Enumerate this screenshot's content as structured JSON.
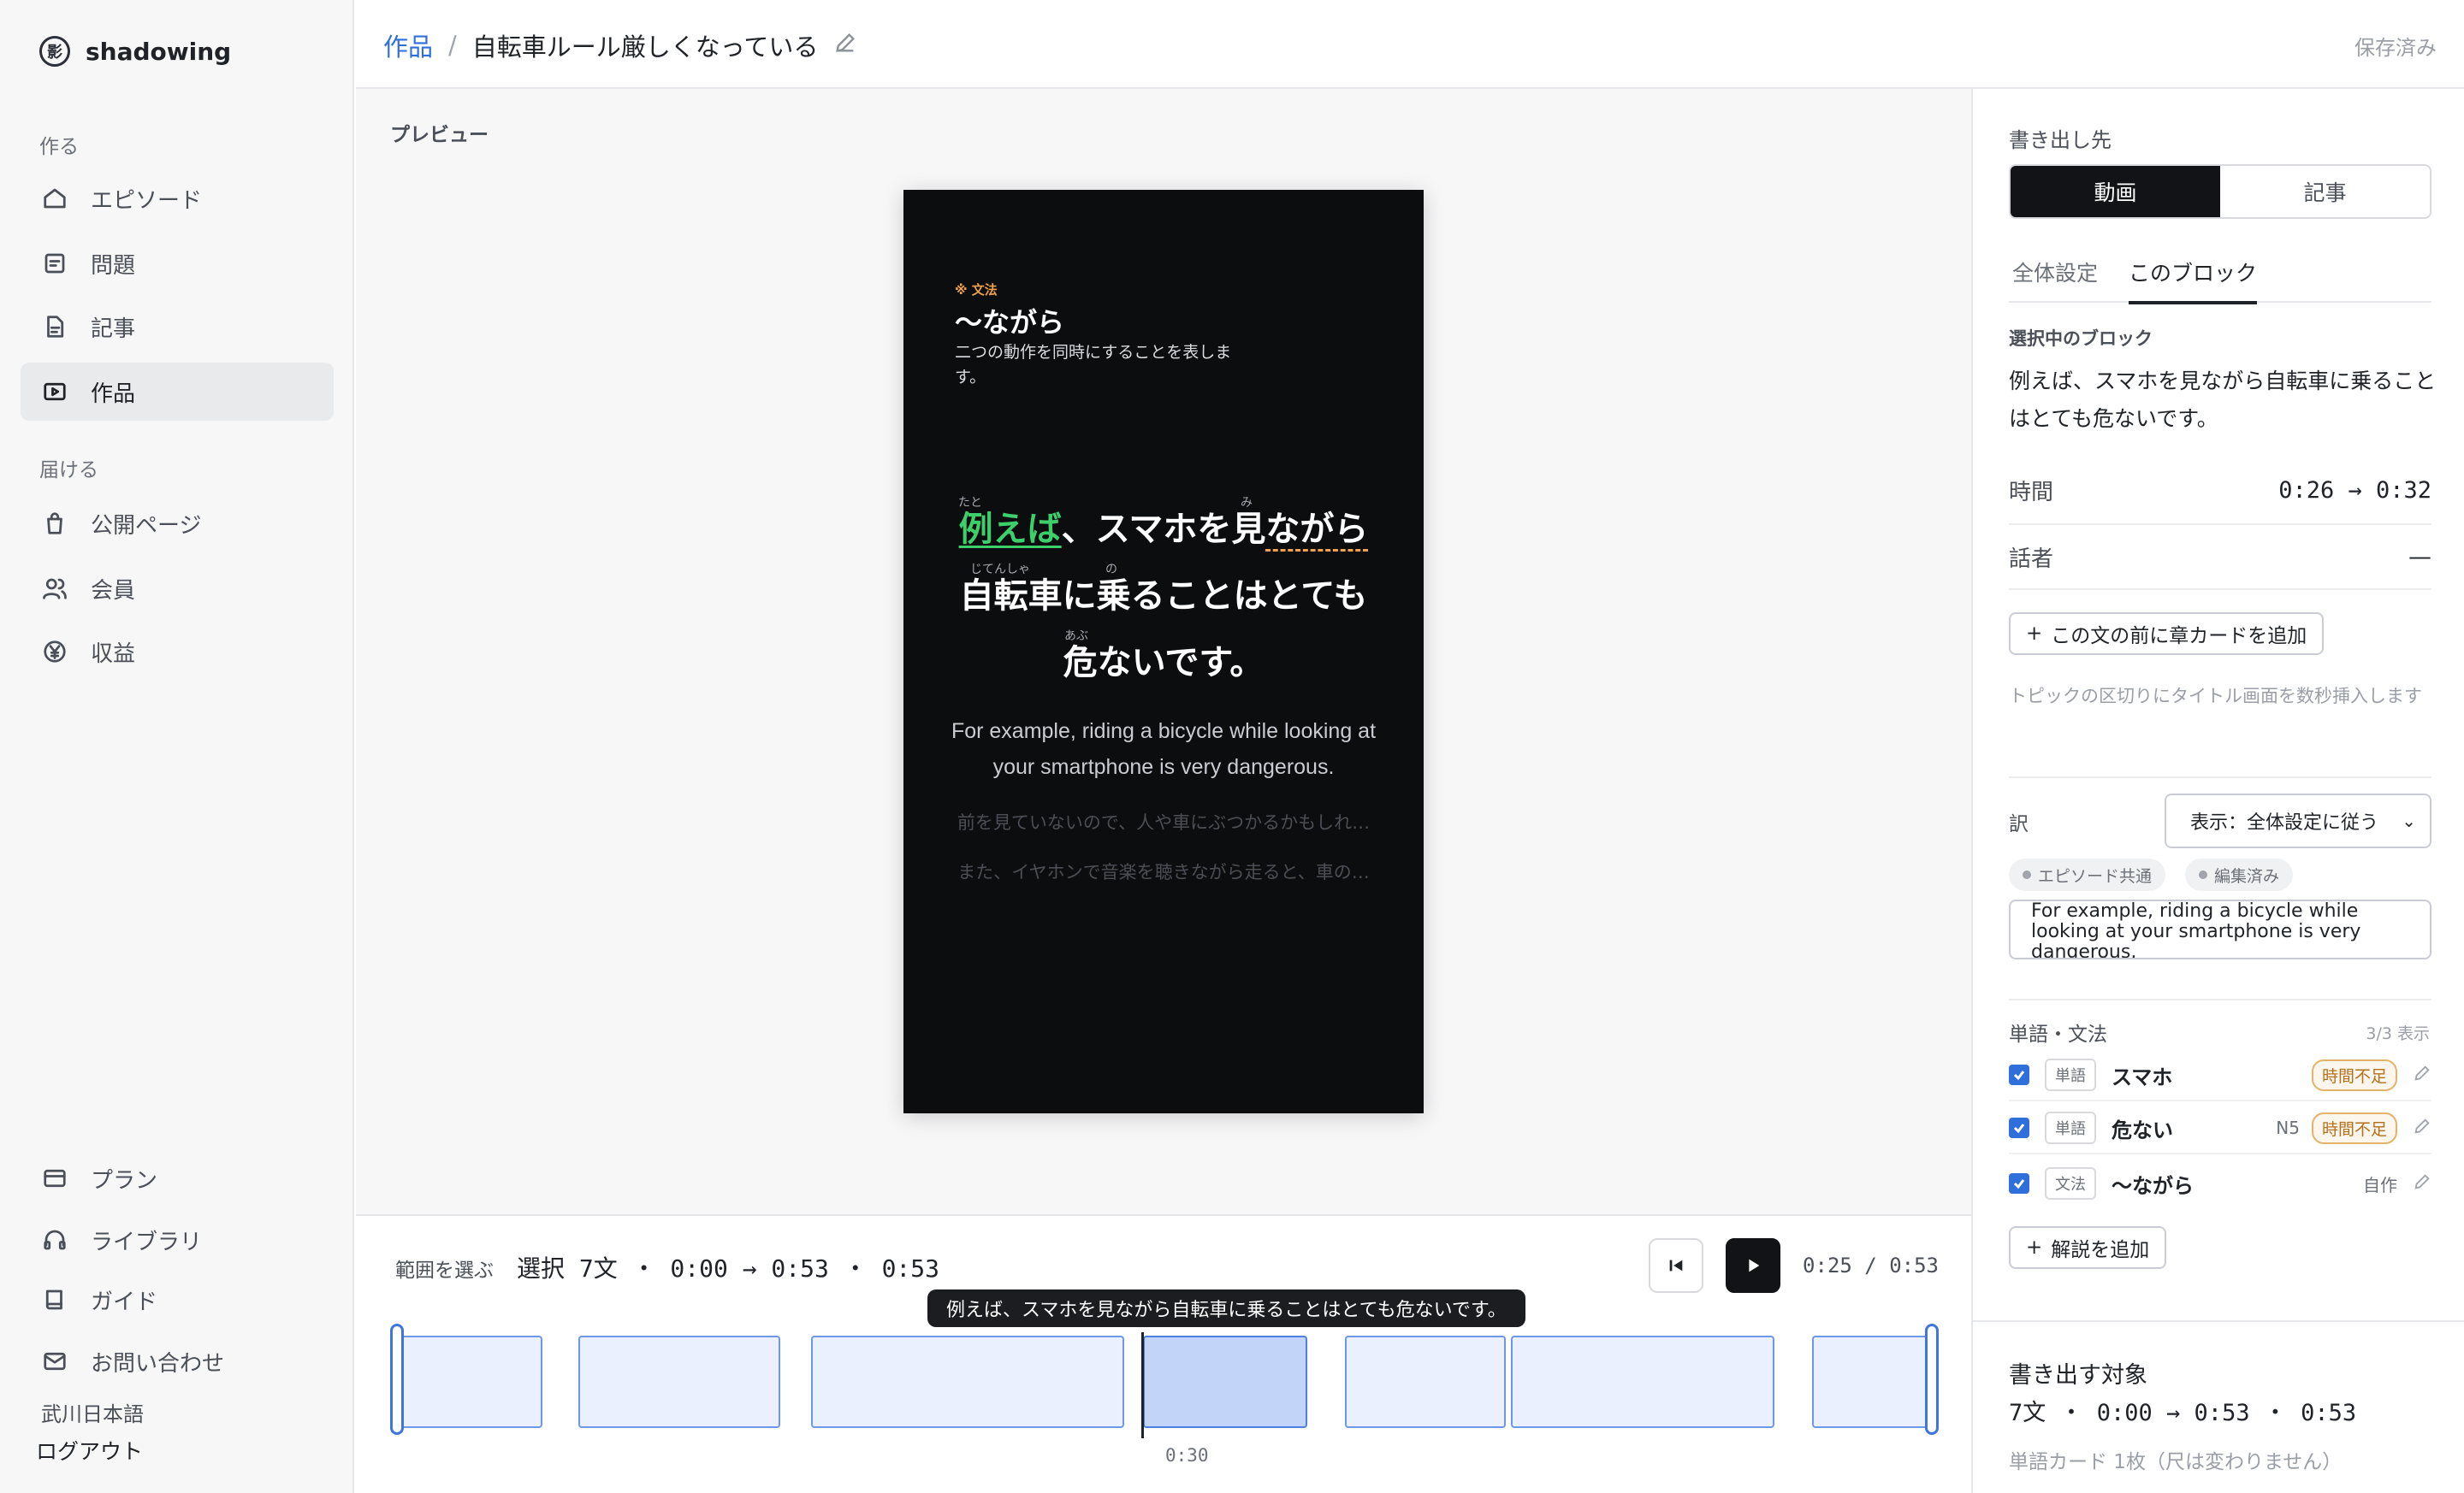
{
  "brand": {
    "name": "shadowing",
    "logo_char": "影"
  },
  "sidebar": {
    "section_create": "作る",
    "section_deliver": "届ける",
    "items": [
      {
        "label": "エピソード",
        "icon": "home-icon"
      },
      {
        "label": "問題",
        "icon": "list-icon"
      },
      {
        "label": "記事",
        "icon": "document-icon"
      },
      {
        "label": "作品",
        "icon": "play-icon"
      },
      {
        "label": "公開ページ",
        "icon": "bag-icon"
      },
      {
        "label": "会員",
        "icon": "users-icon"
      },
      {
        "label": "収益",
        "icon": "yen-icon"
      }
    ],
    "bottom_items": [
      {
        "label": "プラン",
        "icon": "card-icon"
      },
      {
        "label": "ライブラリ",
        "icon": "headphones-icon"
      },
      {
        "label": "ガイド",
        "icon": "book-icon"
      },
      {
        "label": "お問い合わせ",
        "icon": "mail-icon"
      }
    ],
    "org_name": "武川日本語",
    "logout": "ログアウト"
  },
  "header": {
    "breadcrumb_parent": "作品",
    "breadcrumb_sep": "/",
    "title": "自転車ルール厳しくなっている",
    "status": "保存済み"
  },
  "preview": {
    "label": "プレビュー",
    "grammar_tag": "※ 文法",
    "grammar_title": "〜ながら",
    "grammar_desc": "二つの動作を同時にすることを表します。",
    "line1_hl": "例えば",
    "line1_a": "、スマホを見",
    "line1_u": "ながら",
    "line2": "自転車に乗ることはとても",
    "line3": "危ないです。",
    "ruby_tato": "たと",
    "ruby_mi": "み",
    "ruby_jitensha": "じてんしゃ",
    "ruby_no": "の",
    "ruby_abu": "あぶ",
    "translation": "For example, riding a bicycle while looking at your smartphone is very dangerous.",
    "next1": "前を見ていないので、人や車にぶつかるかもしれ…",
    "next2": "また、イヤホンで音楽を聴きながら走ると、車の…"
  },
  "timeline": {
    "range_label": "範囲を選ぶ",
    "summary": "選択 7文 ・ 0:00 → 0:53 ・ 0:53",
    "time": "0:25 / 0:53",
    "tooltip": "例えば、スマホを見ながら自転車に乗ることはとても危ないです。",
    "tick": "0:30"
  },
  "panel": {
    "export_to": "書き出し先",
    "opt_video": "動画",
    "opt_article": "記事",
    "tab_global": "全体設定",
    "tab_block": "このブロック",
    "selected_block_label": "選択中のブロック",
    "selected_block_text": "例えば、スマホを見ながら自転車に乗ることはとても危ないです。",
    "time_label": "時間",
    "time_value": "0:26 → 0:32",
    "speaker_label": "話者",
    "speaker_value": "—",
    "add_chapter": "この文の前に章カードを追加",
    "chapter_hint": "トピックの区切りにタイトル画面を数秒挿入します",
    "translation_label": "訳",
    "translation_select": "表示：全体設定に従う",
    "chip_shared": "エピソード共通",
    "chip_edited": "編集済み",
    "translation_text": "For example, riding a bicycle while looking at your smartphone is very dangerous.",
    "vocab_label": "単語・文法",
    "vocab_count": "3/3 表示",
    "vocab": [
      {
        "type": "単語",
        "word": "スマホ",
        "level": "",
        "badge": "時間不足"
      },
      {
        "type": "単語",
        "word": "危ない",
        "level": "N5",
        "badge": "時間不足"
      },
      {
        "type": "文法",
        "word": "〜ながら",
        "level": "自作",
        "badge": ""
      }
    ],
    "add_note": "解説を追加",
    "export_target_label": "書き出す対象",
    "export_target_value": "7文 ・ 0:00 → 0:53 ・ 0:53",
    "export_note": "単語カード 1枚（尺は変わりません）"
  }
}
